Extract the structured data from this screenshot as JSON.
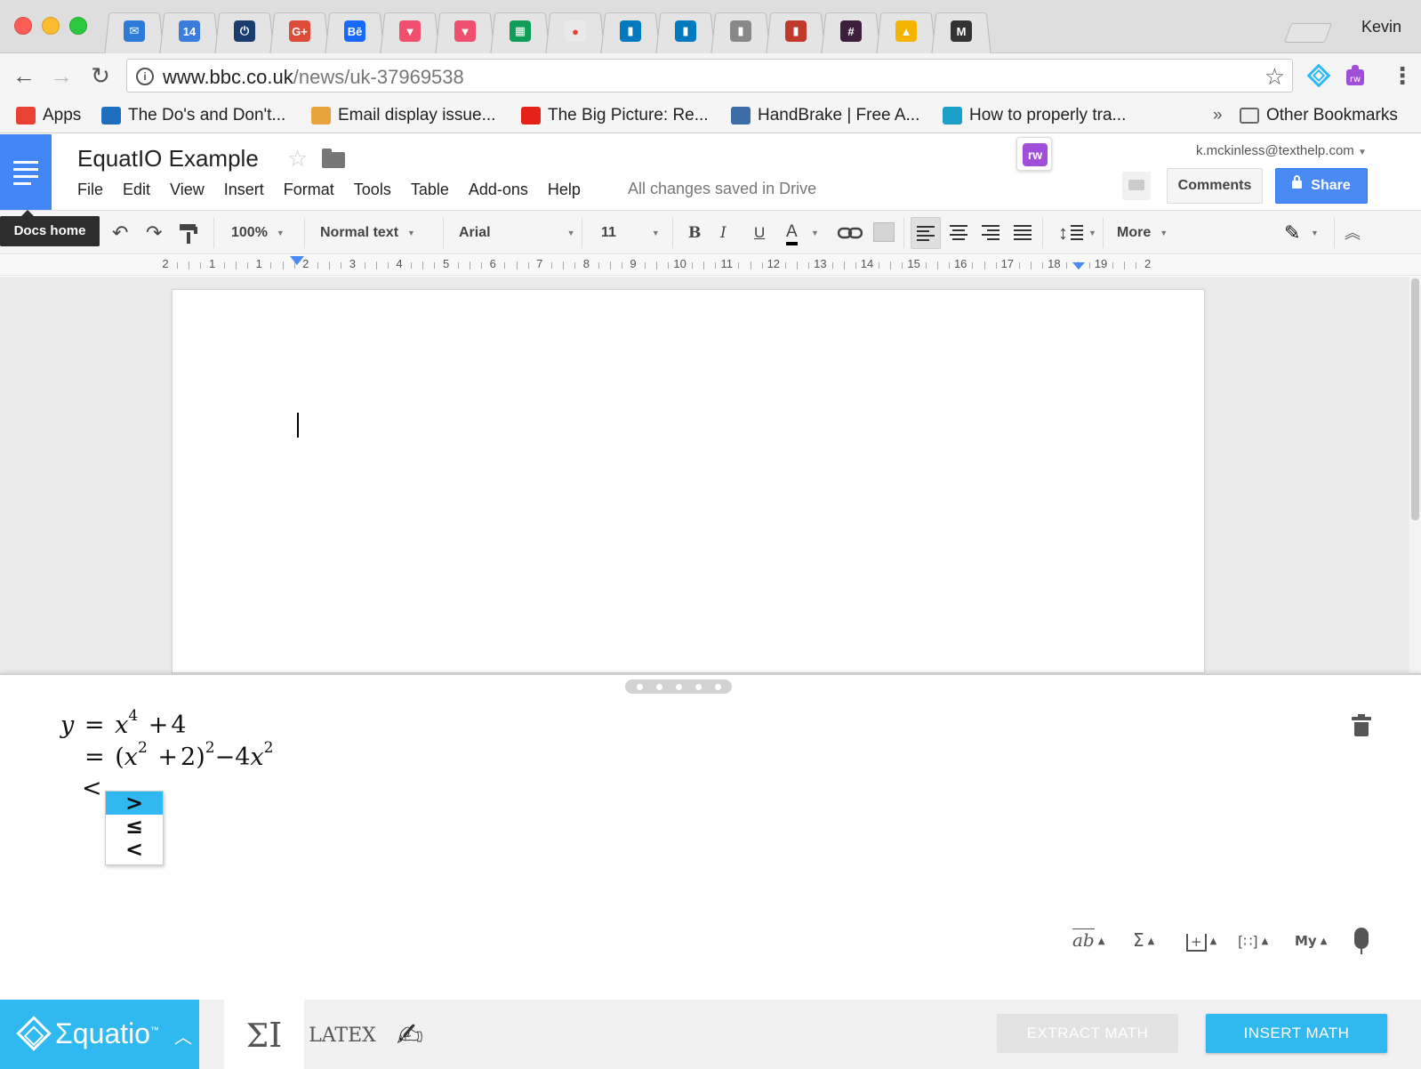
{
  "browser": {
    "profile_name": "Kevin",
    "tabs": [
      {
        "icon": "mail-icon",
        "color": "#2d7bd8",
        "glyph": "✉"
      },
      {
        "icon": "calendar-icon",
        "color": "#3b7ddd",
        "glyph": "14"
      },
      {
        "icon": "power-icon",
        "color": "#1a3c6e",
        "glyph": "⏻"
      },
      {
        "icon": "google-plus-icon",
        "color": "#dd4b39",
        "glyph": "G+"
      },
      {
        "icon": "behance-icon",
        "color": "#1769ff",
        "glyph": "Bē"
      },
      {
        "icon": "pin-icon",
        "color": "#f0506e",
        "glyph": "▼"
      },
      {
        "icon": "pin-icon",
        "color": "#f0506e",
        "glyph": "▼"
      },
      {
        "icon": "sheets-icon",
        "color": "#0f9d58",
        "glyph": "▦"
      },
      {
        "icon": "notification-icon",
        "color": "#e9e9e9",
        "glyph": "●"
      },
      {
        "icon": "trello-icon",
        "color": "#0079bf",
        "glyph": "▮"
      },
      {
        "icon": "trello-icon",
        "color": "#0079bf",
        "glyph": "▮"
      },
      {
        "icon": "trello-icon",
        "color": "#888888",
        "glyph": "▮"
      },
      {
        "icon": "trello-icon",
        "color": "#c0392b",
        "glyph": "▮"
      },
      {
        "icon": "slack-icon",
        "color": "#3d1f3d",
        "glyph": "#"
      },
      {
        "icon": "drive-icon",
        "color": "#f4b400",
        "glyph": "▲"
      },
      {
        "icon": "mastodon-icon",
        "color": "#333333",
        "glyph": "M"
      }
    ],
    "url_host": "www.bbc.co.uk",
    "url_path": "/news/uk-37969538",
    "bookmarks": [
      {
        "label": "Apps",
        "icon": "apps-grid-icon",
        "color": "#e94235"
      },
      {
        "label": "The Do's and Don't...",
        "icon": "v-icon",
        "color": "#1f6fbf"
      },
      {
        "label": "Email display issue...",
        "icon": "pencil-note-icon",
        "color": "#e8a33c"
      },
      {
        "label": "The Big Picture: Re...",
        "icon": "youtube-icon",
        "color": "#e62117"
      },
      {
        "label": "HandBrake | Free A...",
        "icon": "sourceforge-icon",
        "color": "#3d6da7"
      },
      {
        "label": "How to properly tra...",
        "icon": "bookmark-icon",
        "color": "#1aa0c9"
      }
    ],
    "overflow_label": "»",
    "other_bookmarks": "Other Bookmarks"
  },
  "docs": {
    "title": "EquatIO Example",
    "menu": [
      "File",
      "Edit",
      "View",
      "Insert",
      "Format",
      "Tools",
      "Table",
      "Add-ons",
      "Help"
    ],
    "saved_status": "All changes saved in Drive",
    "user_email": "k.mckinless@texthelp.com",
    "comments_label": "Comments",
    "share_label": "Share",
    "rw_label": "rw",
    "docs_home_tooltip": "Docs home",
    "toolbar": {
      "zoom": "100%",
      "style": "Normal text",
      "font": "Arial",
      "font_size": "11",
      "bold": "B",
      "italic": "I",
      "underline": "U",
      "text_color": "A",
      "more": "More"
    },
    "ruler_labels": [
      "2",
      "1",
      "1",
      "2",
      "3",
      "4",
      "5",
      "6",
      "7",
      "8",
      "9",
      "10",
      "11",
      "12",
      "13",
      "14",
      "15",
      "16",
      "17",
      "18",
      "19",
      "2"
    ]
  },
  "equatio": {
    "lines": [
      {
        "lhs": "y",
        "body": [
          "=",
          "x",
          "4",
          "+",
          "4"
        ]
      },
      {
        "body": [
          "=",
          "(x",
          "2",
          "+ 2)",
          "2",
          "−4x",
          "2"
        ]
      },
      {
        "body": [
          "<"
        ]
      }
    ],
    "line1": {
      "var": "y",
      "eq": "=",
      "base": "x",
      "exp": "4",
      "plus": "+",
      "const": "4"
    },
    "line2": {
      "eq": "=",
      "open": "(",
      "base": "x",
      "exp1": "2",
      "plus": "+",
      "const": "2",
      "close": ")",
      "exp2": "2",
      "minus": "−",
      "coef": "4",
      "base2": "x",
      "exp3": "2"
    },
    "line3": {
      "symbol": "<"
    },
    "autocomplete": [
      ">",
      "≤",
      "<"
    ],
    "autocomplete_selected": 0,
    "palette": {
      "text_label": "ab",
      "sigma_label": "Σ",
      "my_label": "My"
    },
    "brand": "Σquatio",
    "brand_mark": "™",
    "mode_latex": "LATEX",
    "extract_label": "EXTRACT MATH",
    "insert_label": "INSERT MATH",
    "accent_color": "#30b8f0"
  }
}
